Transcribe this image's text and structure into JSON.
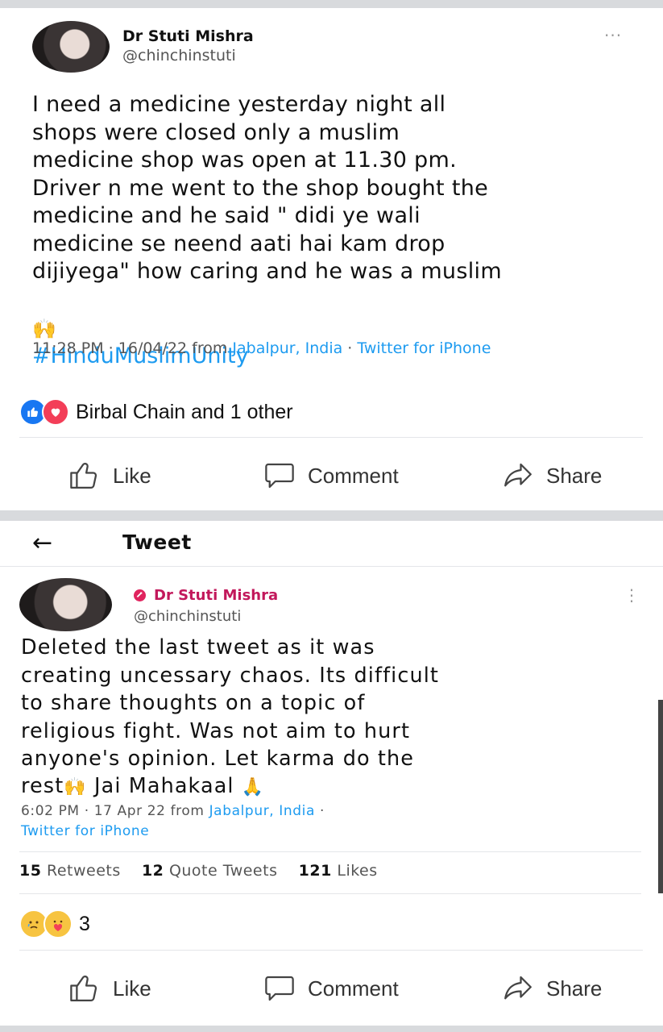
{
  "post1": {
    "author_name": "Dr Stuti Mishra",
    "author_handle": "@chinchinstuti",
    "menu": "···",
    "text": "I need a medicine yesterday night all\nshops were closed only a muslim\nmedicine shop was open at 11.30 pm.\nDriver n me went to the shop bought the\nmedicine and he said \" didi ye wali\nmedicine se neend aati hai kam drop\ndijiyega\" how caring and he was a muslim",
    "hashtag_emoji": "🙌",
    "hashtag": "#HinduMuslimUnity",
    "meta_time": "11:28 PM · 16/04/22 from ",
    "meta_location": "Jabalpur, India",
    "meta_sep": " · ",
    "meta_source": "Twitter for iPhone",
    "reactions_text": "Birbal Chain and 1 other",
    "reaction_icons": [
      "like-icon",
      "love-icon"
    ],
    "actions": {
      "like": "Like",
      "comment": "Comment",
      "share": "Share"
    }
  },
  "post2": {
    "header": {
      "back": "←",
      "title": "Tweet"
    },
    "author_name": "Dr Stuti Mishra",
    "author_handle": "@chinchinstuti",
    "menu": "⋮",
    "text": "Deleted the last tweet as it was\ncreating uncessary chaos. Its difficult\nto share thoughts on a topic of\nreligious fight. Was not aim to hurt\nanyone's opinion. Let karma do the",
    "text_last_1": "rest",
    "text_emoji_1": "🙌",
    "text_last_2": " Jai Mahakaal ",
    "text_emoji_2": "🙏",
    "meta_time": "6:02 PM · 17 Apr 22 from ",
    "meta_location": "Jabalpur, India",
    "meta_sep": " ·",
    "meta_source": "Twitter for iPhone",
    "stats": {
      "retweets_count": "15",
      "retweets_label": "Retweets",
      "quotes_count": "12",
      "quotes_label": "Quote Tweets",
      "likes_count": "121",
      "likes_label": "Likes"
    },
    "reaction_count": "3",
    "reaction_icons": [
      "sad-icon",
      "care-icon"
    ],
    "actions": {
      "like": "Like",
      "comment": "Comment",
      "share": "Share"
    }
  },
  "colors": {
    "link": "#1d9bf0",
    "verified_pink": "#e0245e",
    "like_blue": "#1877f2",
    "love_red": "#f33e58"
  }
}
